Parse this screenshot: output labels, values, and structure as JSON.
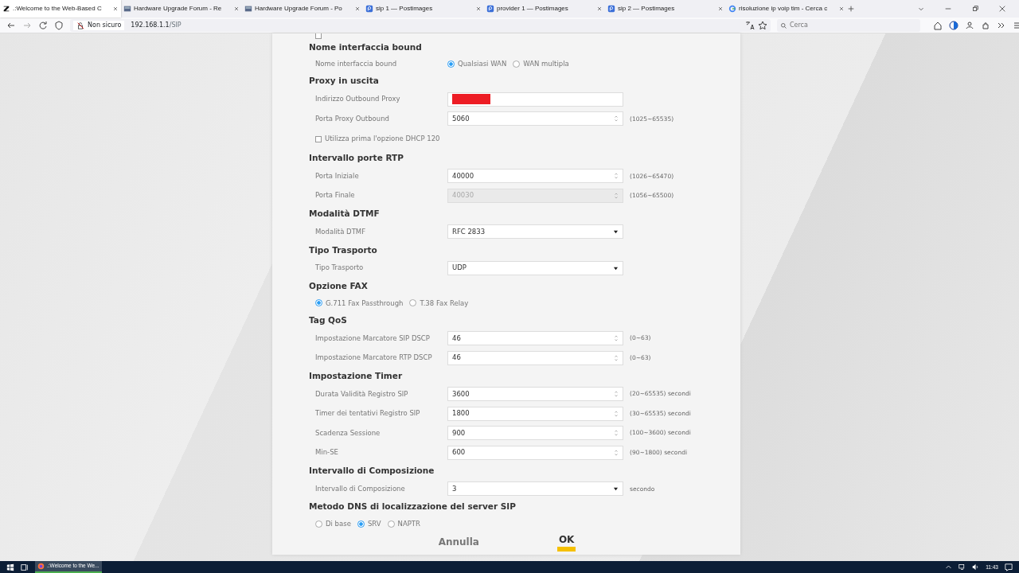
{
  "browser": {
    "tabs": [
      {
        "title": ".:Welcome to the Web-Based C",
        "selected": true
      },
      {
        "title": "Hardware Upgrade Forum - Re",
        "selected": false
      },
      {
        "title": "Hardware Upgrade Forum - Po",
        "selected": false
      },
      {
        "title": "sip 1 — Postimages",
        "selected": false
      },
      {
        "title": "provider 1 — Postimages",
        "selected": false
      },
      {
        "title": "sip 2 — Postimages",
        "selected": false
      },
      {
        "title": "risoluzione ip voip tim - Cerca c",
        "selected": false
      }
    ],
    "security": "Non sicuro",
    "host": "192.168.1.1",
    "path": "/SIP",
    "search_placeholder": "Cerca"
  },
  "form": {
    "top_checkbox": {
      "checked": false
    },
    "sections": [
      {
        "title": "Nome interfaccia bound",
        "rows": [
          {
            "kind": "radio",
            "label": "Nome interfaccia bound",
            "options": [
              {
                "label": "Qualsiasi WAN",
                "selected": true
              },
              {
                "label": "WAN multipla",
                "selected": false
              }
            ]
          }
        ]
      },
      {
        "title": "Proxy in uscita",
        "rows": [
          {
            "kind": "text",
            "label": "Indirizzo Outbound Proxy",
            "redacted": true
          },
          {
            "kind": "number",
            "label": "Porta Proxy Outbound",
            "value": "5060",
            "hint": "(1025~65535)",
            "disabled": false
          },
          {
            "kind": "checkbox",
            "label": "Utilizza prima l'opzione DHCP 120",
            "checked": false
          }
        ]
      },
      {
        "title": "Intervallo porte RTP",
        "rows": [
          {
            "kind": "number",
            "label": "Porta Iniziale",
            "value": "40000",
            "hint": "(1026~65470)",
            "disabled": false
          },
          {
            "kind": "number",
            "label": "Porta Finale",
            "value": "40030",
            "hint": "(1056~65500)",
            "disabled": true
          }
        ]
      },
      {
        "title": "Modalità DTMF",
        "rows": [
          {
            "kind": "select",
            "label": "Modalità DTMF",
            "value": "RFC 2833"
          }
        ]
      },
      {
        "title": "Tipo Trasporto",
        "rows": [
          {
            "kind": "select",
            "label": "Tipo Trasporto",
            "value": "UDP"
          }
        ]
      },
      {
        "title": "Opzione FAX",
        "rows": [
          {
            "kind": "radio",
            "options": [
              {
                "label": "G.711 Fax Passthrough",
                "selected": true
              },
              {
                "label": "T.38 Fax Relay",
                "selected": false
              }
            ]
          }
        ]
      },
      {
        "title": "Tag QoS",
        "rows": [
          {
            "kind": "number",
            "label": "Impostazione Marcatore SIP DSCP",
            "value": "46",
            "hint": "(0~63)",
            "disabled": false
          },
          {
            "kind": "number",
            "label": "Impostazione Marcatore RTP DSCP",
            "value": "46",
            "hint": "(0~63)",
            "disabled": false
          }
        ]
      },
      {
        "title": "Impostazione Timer",
        "rows": [
          {
            "kind": "number",
            "label": "Durata Validità Registro SIP",
            "value": "3600",
            "hint": "(20~65535) secondi",
            "disabled": false
          },
          {
            "kind": "number",
            "label": "Timer dei tentativi Registro SIP",
            "value": "1800",
            "hint": "(30~65535) secondi",
            "disabled": false
          },
          {
            "kind": "number",
            "label": "Scadenza Sessione",
            "value": "900",
            "hint": "(100~3600) secondi",
            "disabled": false
          },
          {
            "kind": "number",
            "label": "Min-SE",
            "value": "600",
            "hint": "(90~1800) secondi",
            "disabled": false
          }
        ]
      },
      {
        "title": "Intervallo di Composizione",
        "rows": [
          {
            "kind": "select",
            "label": "Intervallo di Composizione",
            "value": "3",
            "hint": "secondo"
          }
        ]
      },
      {
        "title": "Metodo DNS di localizzazione del server SIP",
        "rows": [
          {
            "kind": "radio",
            "options": [
              {
                "label": "Di base",
                "selected": false
              },
              {
                "label": "SRV",
                "selected": true
              },
              {
                "label": "NAPTR",
                "selected": false
              }
            ]
          }
        ]
      }
    ],
    "buttons": [
      {
        "label": "Annulla",
        "kind": "cancel"
      },
      {
        "label": "OK",
        "kind": "primary"
      }
    ]
  },
  "taskbar": {
    "app": ".:Welcome to the We...",
    "time": "11:43"
  }
}
